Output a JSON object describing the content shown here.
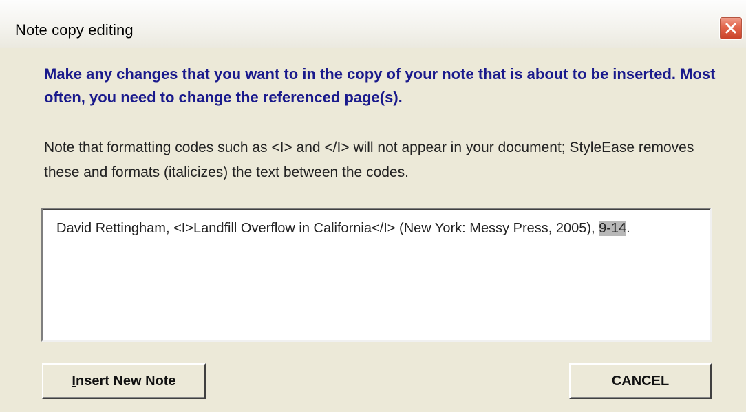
{
  "window": {
    "title": "Note copy editing",
    "close_icon": "close-icon"
  },
  "instructions": {
    "heading": "Make any changes that you want to in the copy of your note that is about to be inserted. Most often, you need to change the referenced page(s).",
    "formatting_note": "Note that formatting codes such as <I> and </I> will not appear in your document; StyleEase removes these and formats (italicizes) the text between the codes."
  },
  "note_editor": {
    "text_before": "David Rettingham, <I>Landfill Overflow in California</I> (New York: Messy Press, 2005), ",
    "selected_text": "9-14",
    "text_after": "."
  },
  "buttons": {
    "insert_mnemonic": "I",
    "insert_rest": "nsert New Note",
    "cancel": "CANCEL"
  },
  "colors": {
    "heading": "#1a1a8c",
    "dialog_bg": "#ece9d8",
    "close_button": "#e2654b"
  }
}
